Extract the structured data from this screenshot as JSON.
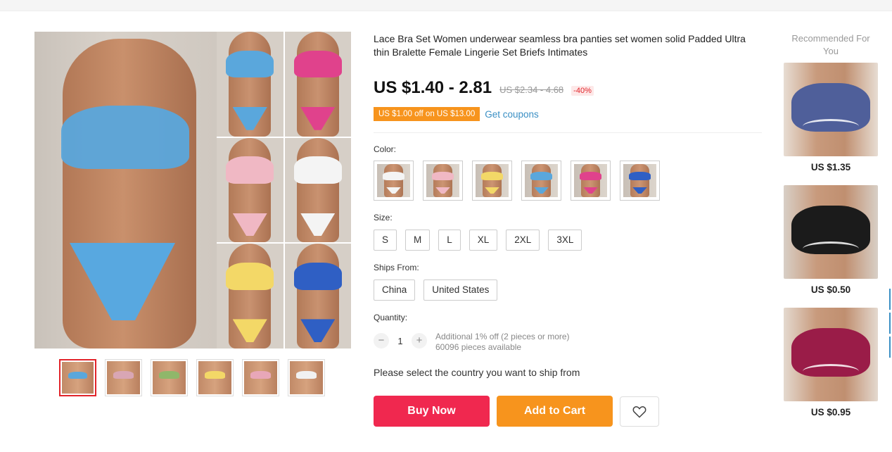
{
  "product": {
    "title": "Lace Bra Set Women underwear seamless bra panties set women solid Padded Ultra thin Bralette Female Lingerie Set Briefs Intimates",
    "price": "US $1.40 - 2.81",
    "original_price": "US $2.34 - 4.68",
    "discount": "-40%",
    "coupon": "US $1.00 off on US $13.00",
    "get_coupons": "Get coupons"
  },
  "gallery": {
    "main_image_icon": "lingerie-product-photo",
    "grid_colors": [
      "#5aa7dc",
      "#e0428c",
      "#f0b8c4",
      "#f4f4f4",
      "#f3d867",
      "#2f5fc4"
    ],
    "thumbnail_colors": [
      "#5aa7dc",
      "#d9a6b4",
      "#8fb76a",
      "#f3d867",
      "#e8a7b8",
      "#f1f1f1"
    ]
  },
  "options": {
    "color_label": "Color:",
    "colors": [
      {
        "bra": "#f4f4f4",
        "panty": "#f4f4f4"
      },
      {
        "bra": "#f0b8c4",
        "panty": "#f0b8c4"
      },
      {
        "bra": "#f3d867",
        "panty": "#f3d867"
      },
      {
        "bra": "#5aa7dc",
        "panty": "#5aa7dc"
      },
      {
        "bra": "#e0428c",
        "panty": "#e0428c"
      },
      {
        "bra": "#2f5fc4",
        "panty": "#2f5fc4"
      }
    ],
    "size_label": "Size:",
    "sizes": [
      "S",
      "M",
      "L",
      "XL",
      "2XL",
      "3XL"
    ],
    "ships_label": "Ships From:",
    "ships_from": [
      "China",
      "United States"
    ],
    "quantity_label": "Quantity:",
    "quantity": "1",
    "minus": "−",
    "plus": "+",
    "quantity_note": "Additional 1% off (2 pieces or more)",
    "available": "60096 pieces available"
  },
  "shipping_message": "Please select the country you want to ship from",
  "actions": {
    "buy_now": "Buy Now",
    "add_to_cart": "Add to Cart",
    "wishlist_icon": "heart-icon"
  },
  "recommended": {
    "title": "Recommended For You",
    "items": [
      {
        "price": "US $1.35",
        "color": "#4f5f9a",
        "bg": "#e7ddd3"
      },
      {
        "price": "US $0.50",
        "color": "#1b1b1b",
        "bg": "#d8cfc6"
      },
      {
        "price": "US $0.95",
        "color": "#9a1c48",
        "bg": "#e4d9cf"
      }
    ]
  },
  "colors": {
    "buy_now": "#f0284f",
    "add_to_cart": "#f7941d",
    "discount": "#e2242a",
    "link": "#3a8fc4"
  }
}
